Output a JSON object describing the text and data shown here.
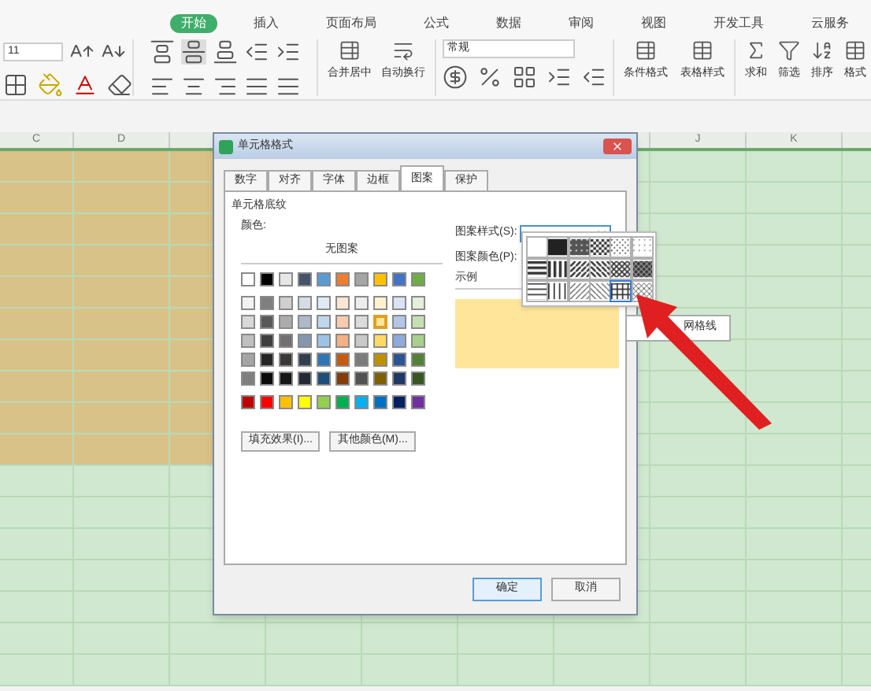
{
  "ribbon": {
    "tabs": [
      {
        "label": "开始",
        "selected": true
      },
      {
        "label": "插入",
        "selected": false
      },
      {
        "label": "页面布局",
        "selected": false
      },
      {
        "label": "公式",
        "selected": false
      },
      {
        "label": "数据",
        "selected": false
      },
      {
        "label": "审阅",
        "selected": false
      },
      {
        "label": "视图",
        "selected": false
      },
      {
        "label": "开发工具",
        "selected": false
      },
      {
        "label": "云服务",
        "selected": false
      }
    ],
    "font_size": "11",
    "number_format": "常规",
    "merge_buttons": [
      "合并居中",
      "自动换行"
    ],
    "style_buttons": [
      "条件格式",
      "表格样式"
    ],
    "tool_buttons": [
      {
        "label": "求和",
        "kind": "sum"
      },
      {
        "label": "筛选",
        "kind": "filter"
      },
      {
        "label": "排序",
        "kind": "sort"
      },
      {
        "label": "格式",
        "kind": "format"
      }
    ]
  },
  "sheet": {
    "columns_left": [
      "C",
      "D"
    ],
    "columns_right": [
      "J",
      "K"
    ]
  },
  "dialog": {
    "title": "单元格格式",
    "tabs": [
      {
        "label": "数字",
        "selected": false
      },
      {
        "label": "对齐",
        "selected": false
      },
      {
        "label": "字体",
        "selected": false
      },
      {
        "label": "边框",
        "selected": false
      },
      {
        "label": "图案",
        "selected": true
      },
      {
        "label": "保护",
        "selected": false
      }
    ],
    "group_title": "单元格底纹",
    "color_label": "颜色:",
    "no_pattern": "无图案",
    "palette": [
      [
        {
          "color": "#ffffff",
          "selected": false
        },
        {
          "color": "#000000",
          "selected": false
        },
        {
          "color": "#e7e6e6",
          "selected": false
        },
        {
          "color": "#44546a",
          "selected": false
        },
        {
          "color": "#5b9bd5",
          "selected": false
        },
        {
          "color": "#ed7d31",
          "selected": false
        },
        {
          "color": "#a5a5a5",
          "selected": false
        },
        {
          "color": "#ffc000",
          "selected": false
        },
        {
          "color": "#4472c4",
          "selected": false
        },
        {
          "color": "#70ad47",
          "selected": false
        }
      ],
      [
        {
          "color": "#f2f2f2",
          "selected": false
        },
        {
          "color": "#7f7f7f",
          "selected": false
        },
        {
          "color": "#d0cece",
          "selected": false
        },
        {
          "color": "#d6dce4",
          "selected": false
        },
        {
          "color": "#deebf6",
          "selected": false
        },
        {
          "color": "#fbe5d5",
          "selected": false
        },
        {
          "color": "#ededed",
          "selected": false
        },
        {
          "color": "#fff2cc",
          "selected": false
        },
        {
          "color": "#dae3f3",
          "selected": false
        },
        {
          "color": "#e2efd9",
          "selected": false
        }
      ],
      [
        {
          "color": "#d8d8d8",
          "selected": false
        },
        {
          "color": "#595959",
          "selected": false
        },
        {
          "color": "#aeabab",
          "selected": false
        },
        {
          "color": "#adb9ca",
          "selected": false
        },
        {
          "color": "#bdd7ee",
          "selected": false
        },
        {
          "color": "#f7cbac",
          "selected": false
        },
        {
          "color": "#dbdbdb",
          "selected": false
        },
        {
          "color": "#fee599",
          "selected": true
        },
        {
          "color": "#b4c6e7",
          "selected": false
        },
        {
          "color": "#c5e0b3",
          "selected": false
        }
      ],
      [
        {
          "color": "#bfbfbf",
          "selected": false
        },
        {
          "color": "#3f3f3f",
          "selected": false
        },
        {
          "color": "#757070",
          "selected": false
        },
        {
          "color": "#8496b0",
          "selected": false
        },
        {
          "color": "#9cc3e5",
          "selected": false
        },
        {
          "color": "#f4b183",
          "selected": false
        },
        {
          "color": "#c9c9c9",
          "selected": false
        },
        {
          "color": "#ffd965",
          "selected": false
        },
        {
          "color": "#8eaadb",
          "selected": false
        },
        {
          "color": "#a8d08d",
          "selected": false
        }
      ],
      [
        {
          "color": "#a5a5a5",
          "selected": false
        },
        {
          "color": "#262626",
          "selected": false
        },
        {
          "color": "#3a3838",
          "selected": false
        },
        {
          "color": "#323f4f",
          "selected": false
        },
        {
          "color": "#2e75b5",
          "selected": false
        },
        {
          "color": "#c55a11",
          "selected": false
        },
        {
          "color": "#7b7b7b",
          "selected": false
        },
        {
          "color": "#bf9000",
          "selected": false
        },
        {
          "color": "#2f5496",
          "selected": false
        },
        {
          "color": "#538135",
          "selected": false
        }
      ],
      [
        {
          "color": "#7f7f7f",
          "selected": false
        },
        {
          "color": "#0c0c0c",
          "selected": false
        },
        {
          "color": "#171616",
          "selected": false
        },
        {
          "color": "#222a35",
          "selected": false
        },
        {
          "color": "#1e4e79",
          "selected": false
        },
        {
          "color": "#833c0b",
          "selected": false
        },
        {
          "color": "#525252",
          "selected": false
        },
        {
          "color": "#7f6000",
          "selected": false
        },
        {
          "color": "#1f3864",
          "selected": false
        },
        {
          "color": "#375623",
          "selected": false
        }
      ],
      [
        {
          "color": "#c00000",
          "selected": false
        },
        {
          "color": "#ff0000",
          "selected": false
        },
        {
          "color": "#ffc000",
          "selected": false
        },
        {
          "color": "#ffff00",
          "selected": false
        },
        {
          "color": "#92d050",
          "selected": false
        },
        {
          "color": "#00b050",
          "selected": false
        },
        {
          "color": "#00b0f0",
          "selected": false
        },
        {
          "color": "#0070c0",
          "selected": false
        },
        {
          "color": "#002060",
          "selected": false
        },
        {
          "color": "#7030a0",
          "selected": false
        }
      ]
    ],
    "fill_effects_button": "填充效果(I)...",
    "more_colors_button": "其他颜色(M)...",
    "pattern_style_label": "图案样式(S):",
    "pattern_color_label": "图案颜色(P):",
    "sample_label": "示例",
    "patterns": [
      {
        "kind": "none",
        "selected": false
      },
      {
        "kind": "solid",
        "selected": false
      },
      {
        "kind": "gray75",
        "selected": false
      },
      {
        "kind": "gray50",
        "selected": false
      },
      {
        "kind": "gray25",
        "selected": false
      },
      {
        "kind": "gray12",
        "selected": false
      },
      {
        "kind": "hstripe",
        "selected": false
      },
      {
        "kind": "vstripe",
        "selected": false
      },
      {
        "kind": "rdiag",
        "selected": false
      },
      {
        "kind": "ldiag",
        "selected": false
      },
      {
        "kind": "crossdiag",
        "selected": false
      },
      {
        "kind": "thickcross",
        "selected": false
      },
      {
        "kind": "thinh",
        "selected": false
      },
      {
        "kind": "thinv",
        "selected": false
      },
      {
        "kind": "thinrdiag",
        "selected": false
      },
      {
        "kind": "thinldiag",
        "selected": false
      },
      {
        "kind": "thingrid",
        "selected": true
      },
      {
        "kind": "thincross",
        "selected": false
      }
    ],
    "tooltip": "网格线",
    "ok_button": "确定",
    "cancel_button": "取消"
  }
}
